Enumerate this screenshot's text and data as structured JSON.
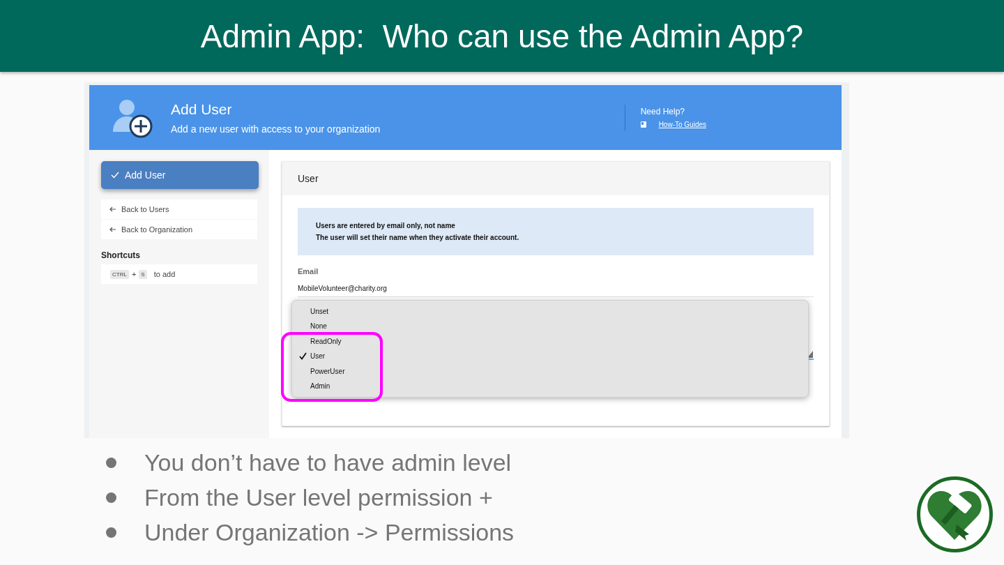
{
  "slide": {
    "title": "Admin App:  Who can use the Admin App?"
  },
  "app": {
    "header": {
      "title": "Add User",
      "subtitle": "Add a new user with access to your organization",
      "help_title": "Need Help?",
      "help_link": "How-To Guides"
    },
    "sidebar": {
      "primary_button": "Add User",
      "links": [
        "Back to Users",
        "Back to Organization"
      ],
      "shortcuts_heading": "Shortcuts",
      "shortcut": {
        "keys": [
          "CTRL",
          "S"
        ],
        "joiner": "+",
        "text": "to add"
      }
    },
    "card": {
      "title": "User",
      "notice": [
        "Users are entered by email only, not name",
        "The user will set their name when they activate their account."
      ],
      "email_label": "Email",
      "email_value": "MobileVolunteer@charity.org"
    },
    "dropdown": {
      "options": [
        {
          "label": "Unset",
          "selected": false
        },
        {
          "label": "None",
          "selected": false
        },
        {
          "label": "ReadOnly",
          "selected": false
        },
        {
          "label": "User",
          "selected": true
        },
        {
          "label": "PowerUser",
          "selected": false
        },
        {
          "label": "Admin",
          "selected": false
        }
      ]
    }
  },
  "bullets": [
    "You don’t have to have admin level",
    "From the User level permission +",
    "Under Organization -> Permissions"
  ]
}
